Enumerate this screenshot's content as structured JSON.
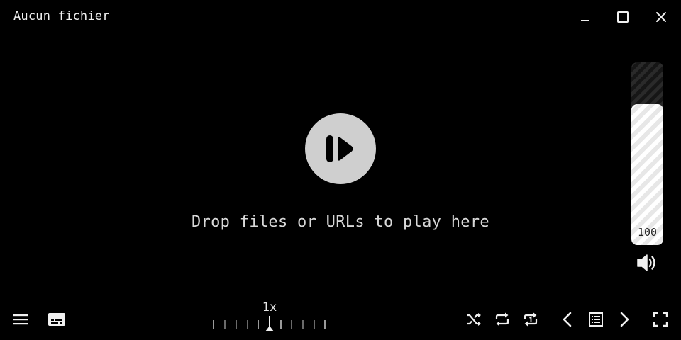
{
  "window": {
    "title": "Aucun fichier",
    "controls": [
      "minimize-icon",
      "maximize-icon",
      "close-icon"
    ]
  },
  "center": {
    "play_icon": "play-pause-icon",
    "drop_hint": "Drop files or URLs to play here"
  },
  "volume": {
    "value_label": "100",
    "level_fraction": 0.77,
    "icon": "speaker-icon"
  },
  "bottom_bar": {
    "left_icons": [
      "menu-icon",
      "subtitles-icon"
    ],
    "speed": {
      "label": "1x"
    },
    "right_icons": [
      "shuffle-icon",
      "repeat-icon",
      "repeat-one-icon",
      "previous-icon",
      "playlist-icon",
      "next-icon",
      "fullscreen-icon"
    ]
  },
  "colors": {
    "background": "#000000",
    "foreground": "#e6e6e6",
    "play_button": "#cfcfcf"
  }
}
